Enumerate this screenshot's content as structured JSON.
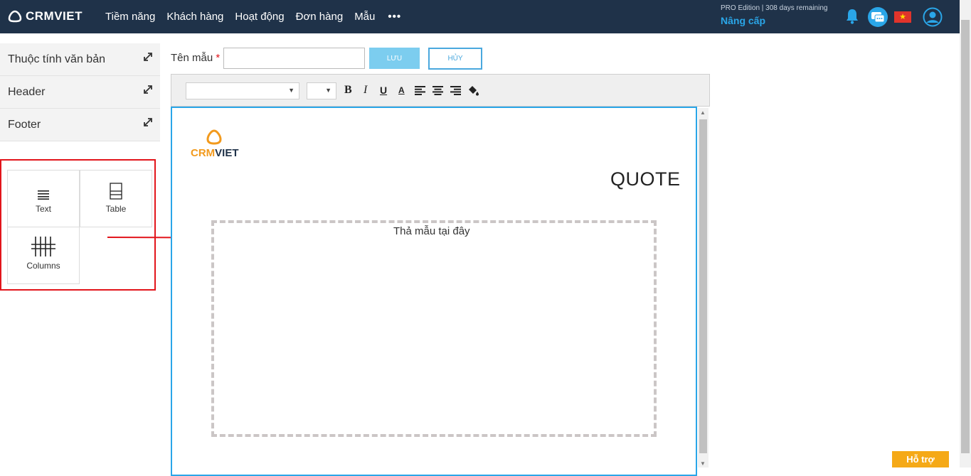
{
  "header": {
    "brand": "CRMVIET",
    "nav": [
      "Tiềm năng",
      "Khách hàng",
      "Hoạt động",
      "Đơn hàng",
      "Mẫu"
    ],
    "more": "•••",
    "edition": "PRO Edition | 308 days remaining",
    "upgrade": "Nâng cấp",
    "icons": [
      "bell-icon",
      "chat-icon",
      "flag-vietnam-icon",
      "user-avatar-icon"
    ]
  },
  "sidebar": {
    "sections": [
      {
        "label": "Thuộc tính văn bản"
      },
      {
        "label": "Header"
      },
      {
        "label": "Footer"
      }
    ],
    "blocks": [
      {
        "label": "Text",
        "icon": "text-lines-icon"
      },
      {
        "label": "Table",
        "icon": "table-icon"
      },
      {
        "label": "Columns",
        "icon": "columns-icon"
      }
    ]
  },
  "form": {
    "name_label": "Tên mẫu",
    "required_mark": "*",
    "name_value": "",
    "save_label": "LƯU",
    "cancel_label": "HỦY"
  },
  "toolbar": {
    "font_family": "",
    "font_size": "",
    "buttons": [
      "B",
      "I",
      "U",
      "A"
    ]
  },
  "document": {
    "logo_crm": "CRM",
    "logo_viet": "VIET",
    "title": "QUOTE",
    "drop_hint": "Thả mẫu tại đây"
  },
  "support": {
    "label": "Hỗ trợ"
  },
  "colors": {
    "nav_bg": "#1f3249",
    "accent": "#2aa6e8",
    "highlight": "#e2151b",
    "logo_orange": "#f29a1d",
    "support": "#f5a917"
  }
}
